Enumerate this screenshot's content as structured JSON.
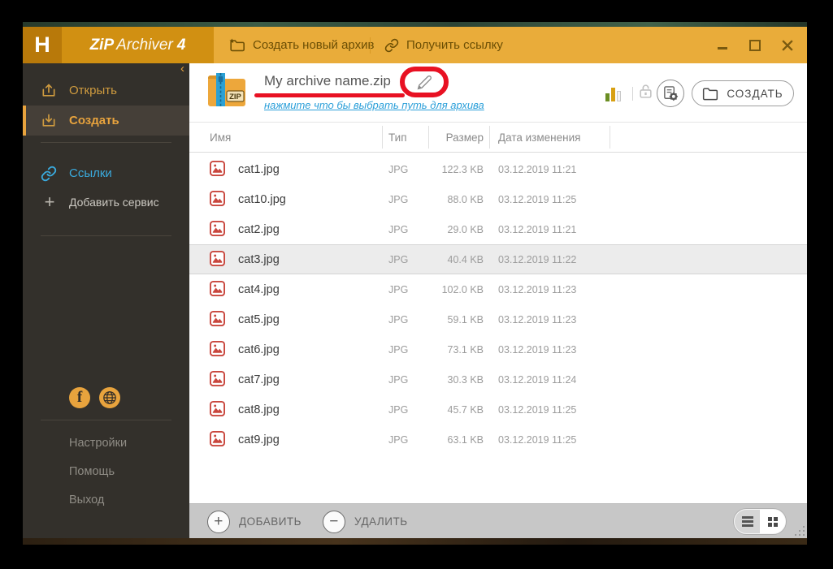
{
  "brand": {
    "logo_letter": "H",
    "name_bold": "ZiP",
    "name_light": "Archiver",
    "version": "4"
  },
  "tabs": [
    {
      "label": "Создать новый архив"
    },
    {
      "label": "Получить ссылку"
    }
  ],
  "sidebar": {
    "collapse_glyph": "‹",
    "items": [
      {
        "label": "Открыть",
        "active": false
      },
      {
        "label": "Создать",
        "active": true
      },
      {
        "label": "Ссылки",
        "active": false
      },
      {
        "label": "Добавить сервис",
        "active": false
      }
    ],
    "service_plus_glyph": "+",
    "facebook_glyph": "f",
    "footer_items": [
      {
        "label": "Настройки"
      },
      {
        "label": "Помощь"
      },
      {
        "label": "Выход"
      }
    ]
  },
  "header": {
    "archive_name": "My archive name.zip",
    "path_link": "нажмите что бы выбрать путь для архива",
    "create_label": "СОЗДАТЬ",
    "zip_badge": "ZIP"
  },
  "table": {
    "columns": [
      "Имя",
      "Тип",
      "Размер",
      "Дата изменения"
    ],
    "rows": [
      {
        "name": "cat1.jpg",
        "type": "JPG",
        "size": "122.3 KB",
        "date": "03.12.2019 11:21",
        "selected": false
      },
      {
        "name": "cat10.jpg",
        "type": "JPG",
        "size": "88.0 KB",
        "date": "03.12.2019 11:25",
        "selected": false
      },
      {
        "name": "cat2.jpg",
        "type": "JPG",
        "size": "29.0 KB",
        "date": "03.12.2019 11:21",
        "selected": false
      },
      {
        "name": "cat3.jpg",
        "type": "JPG",
        "size": "40.4 KB",
        "date": "03.12.2019 11:22",
        "selected": true
      },
      {
        "name": "cat4.jpg",
        "type": "JPG",
        "size": "102.0 KB",
        "date": "03.12.2019 11:23",
        "selected": false
      },
      {
        "name": "cat5.jpg",
        "type": "JPG",
        "size": "59.1 KB",
        "date": "03.12.2019 11:23",
        "selected": false
      },
      {
        "name": "cat6.jpg",
        "type": "JPG",
        "size": "73.1 KB",
        "date": "03.12.2019 11:23",
        "selected": false
      },
      {
        "name": "cat7.jpg",
        "type": "JPG",
        "size": "30.3 KB",
        "date": "03.12.2019 11:24",
        "selected": false
      },
      {
        "name": "cat8.jpg",
        "type": "JPG",
        "size": "45.7 KB",
        "date": "03.12.2019 11:25",
        "selected": false
      },
      {
        "name": "cat9.jpg",
        "type": "JPG",
        "size": "63.1 KB",
        "date": "03.12.2019 11:25",
        "selected": false
      }
    ]
  },
  "footer": {
    "add_label": "ДОБАВИТЬ",
    "remove_label": "УДАЛИТЬ"
  },
  "colors": {
    "accent": "#e8a33d",
    "titlebar": "#d19012",
    "titlebar-dark": "#b8790a",
    "tabstrip": "#e9ac3a",
    "tab-text": "#6b4e04",
    "sidebar-bg": "#33302b",
    "sidebar-active": "#453f38",
    "links-blue": "#3aabdf",
    "link-blue": "#2b9fd9",
    "annotation-red": "#e81123",
    "row-selected": "#ececec",
    "footer-bar": "#c7c7c7"
  }
}
